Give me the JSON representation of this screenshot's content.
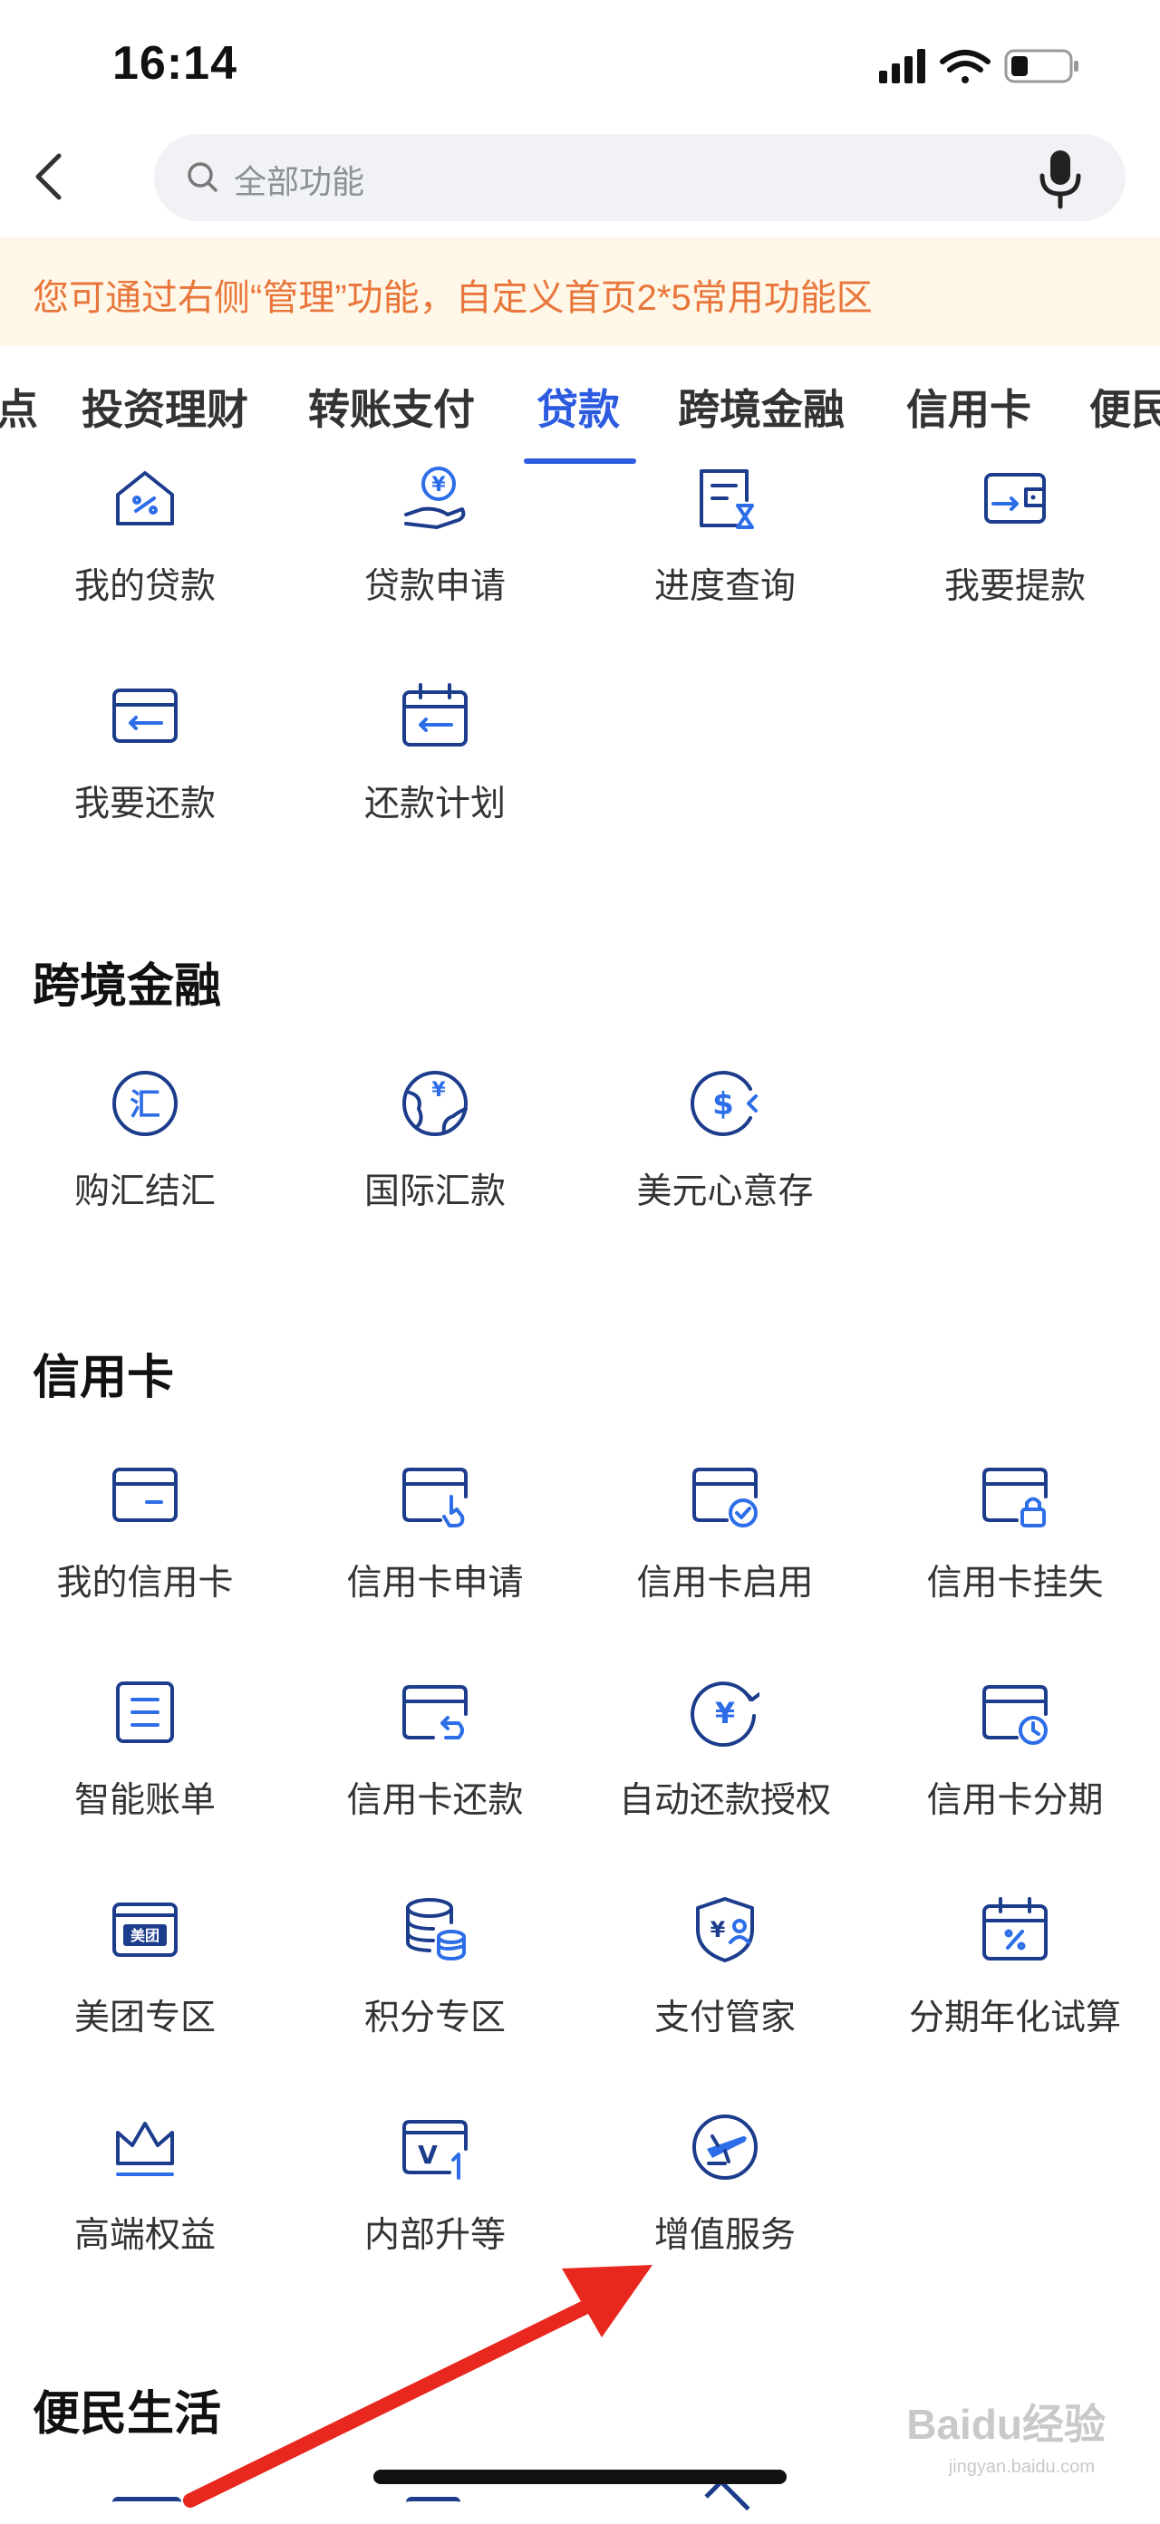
{
  "status": {
    "time": "16:14"
  },
  "search": {
    "placeholder": "全部功能"
  },
  "notice": {
    "text": "您可通过右侧“管理”功能，自定义首页2*5常用功能区"
  },
  "tabs": [
    {
      "label": "点"
    },
    {
      "label": "投资理财"
    },
    {
      "label": "转账支付"
    },
    {
      "label": "贷款",
      "active": true
    },
    {
      "label": "跨境金融"
    },
    {
      "label": "信用卡"
    },
    {
      "label": "便民"
    }
  ],
  "loan": {
    "items": [
      {
        "label": "我的贷款",
        "icon": "house-percent-icon"
      },
      {
        "label": "贷款申请",
        "icon": "hand-yuan-icon"
      },
      {
        "label": "进度查询",
        "icon": "document-hourglass-icon"
      },
      {
        "label": "我要提款",
        "icon": "wallet-icon"
      },
      {
        "label": "我要还款",
        "icon": "card-return-icon"
      },
      {
        "label": "还款计划",
        "icon": "calendar-return-icon"
      }
    ]
  },
  "cross_border": {
    "title": "跨境金融",
    "items": [
      {
        "label": "购汇结汇",
        "icon": "exchange-icon"
      },
      {
        "label": "国际汇款",
        "icon": "globe-yuan-icon"
      },
      {
        "label": "美元心意存",
        "icon": "dollar-coin-icon"
      }
    ]
  },
  "credit_card": {
    "title": "信用卡",
    "items": [
      {
        "label": "我的信用卡",
        "icon": "credit-card-icon"
      },
      {
        "label": "信用卡申请",
        "icon": "card-tap-icon"
      },
      {
        "label": "信用卡启用",
        "icon": "card-check-icon"
      },
      {
        "label": "信用卡挂失",
        "icon": "card-lock-icon"
      },
      {
        "label": "智能账单",
        "icon": "bill-icon"
      },
      {
        "label": "信用卡还款",
        "icon": "card-repay-icon"
      },
      {
        "label": "自动还款授权",
        "icon": "auto-yuan-icon"
      },
      {
        "label": "信用卡分期",
        "icon": "card-clock-icon"
      },
      {
        "label": "美团专区",
        "icon": "meituan-icon"
      },
      {
        "label": "积分专区",
        "icon": "points-stack-icon"
      },
      {
        "label": "支付管家",
        "icon": "shield-user-icon"
      },
      {
        "label": "分期年化试算",
        "icon": "calendar-percent-icon"
      },
      {
        "label": "高端权益",
        "icon": "crown-icon"
      },
      {
        "label": "内部升等",
        "icon": "card-upgrade-icon"
      },
      {
        "label": "增值服务",
        "icon": "plane-icon"
      }
    ],
    "meituan_badge": "美团",
    "upgrade_badge": "V"
  },
  "life": {
    "title": "便民生活"
  },
  "watermark": {
    "text": "Baidu经验",
    "sub": "jingyan.baidu.com"
  },
  "colors": {
    "accent": "#2c5be0",
    "notice_text": "#e8763a",
    "notice_bg": "#fff7e8",
    "icon_dark": "#1c3c8c",
    "icon_light": "#2d6ee8",
    "arrow": "#e8281e"
  }
}
